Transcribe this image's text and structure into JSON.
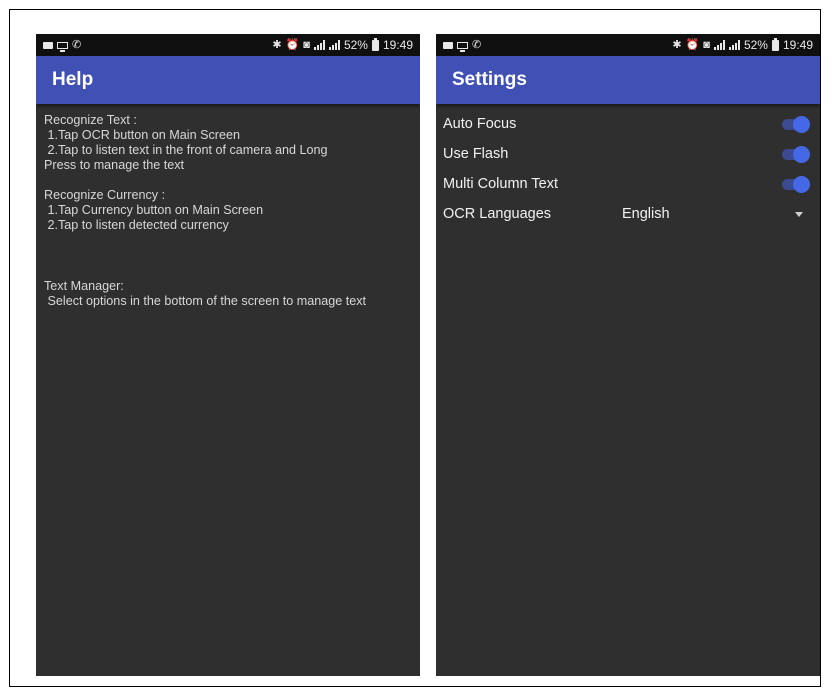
{
  "status_bar": {
    "battery": "52%",
    "time": "19:49"
  },
  "help": {
    "title": "Help",
    "recognize_text": {
      "heading": "Recognize Text :",
      "lines": [
        " 1.Tap OCR button on Main Screen",
        " 2.Tap to listen text in the front of camera and Long",
        "Press to manage the text"
      ]
    },
    "recognize_currency": {
      "heading": "Recognize Currency :",
      "lines": [
        " 1.Tap Currency button on Main Screen",
        " 2.Tap to listen detected currency"
      ]
    },
    "text_manager": {
      "heading": "Text Manager:",
      "lines": [
        " Select options in the bottom of the screen to manage text"
      ]
    }
  },
  "settings": {
    "title": "Settings",
    "items": [
      {
        "label": "Auto Focus",
        "enabled": true
      },
      {
        "label": "Use Flash",
        "enabled": true
      },
      {
        "label": "Multi Column Text",
        "enabled": true
      }
    ],
    "ocr_languages": {
      "label": "OCR Languages",
      "value": "English"
    }
  },
  "colors": {
    "app_bar": "#4050b4",
    "background": "#2f2f2f",
    "status_bar": "#101010",
    "toggle_thumb": "#4568e6"
  }
}
